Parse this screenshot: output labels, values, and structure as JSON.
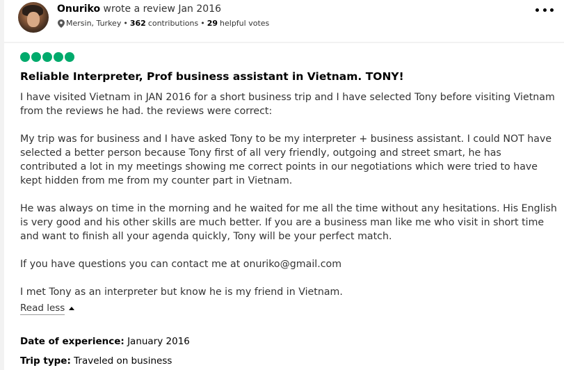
{
  "reviewer": {
    "name": "Onuriko",
    "action": "wrote a review Jan 2016",
    "location": "Mersin, Turkey",
    "contributions_count": "362",
    "contributions_label": "contributions",
    "helpful_count": "29",
    "helpful_label": "helpful votes",
    "separator": "•"
  },
  "review": {
    "rating": 5,
    "rating_color": "#00aa6c",
    "title": "Reliable Interpreter, Prof business assistant in Vietnam. TONY!",
    "paragraphs": [
      "I have visited Vietnam in JAN 2016 for a short business trip and I have selected Tony before visiting Vietnam from the reviews he had. the reviews were correct:",
      "My trip was for business and I have asked Tony to be my interpreter + business assistant. I could NOT have selected a better person because Tony first of all very friendly, outgoing and street smart, he has contributed a lot in my meetings showing me correct points in our negotiations which were tried to have kept hidden from me from my counter part in Vietnam.",
      "He was always on time in the morning and he waited for me all the time without any hesitations. His English is very good and his other skills are much better. If you are a business man like me who visit in short time and want to finish all your agenda quickly, Tony will be your perfect match.",
      "If you have questions you can contact me at onuriko@gmail.com",
      "I met Tony as an interpreter but know he is my friend in Vietnam."
    ],
    "read_less_label": "Read less",
    "date_of_experience_label": "Date of experience:",
    "date_of_experience_value": "January 2016",
    "trip_type_label": "Trip type:",
    "trip_type_value": "Traveled on business"
  },
  "icons": {
    "more": "more-options-icon",
    "location": "map-pin-icon",
    "collapse": "caret-up-icon"
  }
}
